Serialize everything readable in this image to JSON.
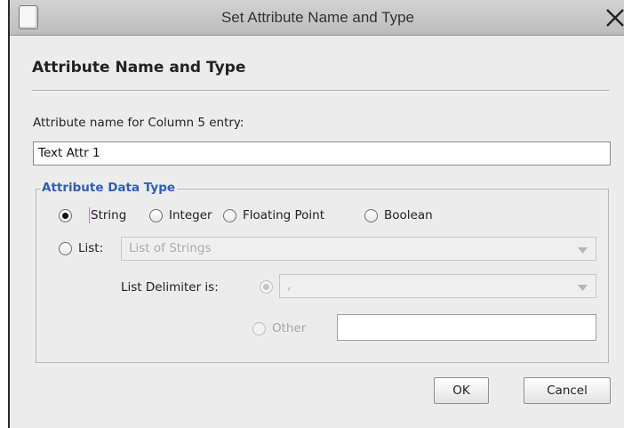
{
  "window": {
    "title": "Set Attribute Name and Type"
  },
  "section": {
    "heading": "Attribute Name and Type"
  },
  "name_field": {
    "label": "Attribute name for Column 5 entry:",
    "value": "Text Attr 1"
  },
  "data_type": {
    "legend": "Attribute Data Type",
    "options": [
      {
        "label": "String",
        "checked": true
      },
      {
        "label": "Integer",
        "checked": false
      },
      {
        "label": "Floating Point",
        "checked": false
      },
      {
        "label": "Boolean",
        "checked": false
      }
    ],
    "list": {
      "label": "List:",
      "selected": "List of Strings",
      "enabled": false
    },
    "delimiter": {
      "label": "List Delimiter is:",
      "selected": ",",
      "other_label": "Other",
      "other_value": "",
      "enabled": false
    }
  },
  "buttons": {
    "ok": "OK",
    "cancel": "Cancel"
  },
  "colors": {
    "legend": "#2f5fb4",
    "dialog_bg": "#ececec",
    "titlebar": "#c8c8c8"
  }
}
